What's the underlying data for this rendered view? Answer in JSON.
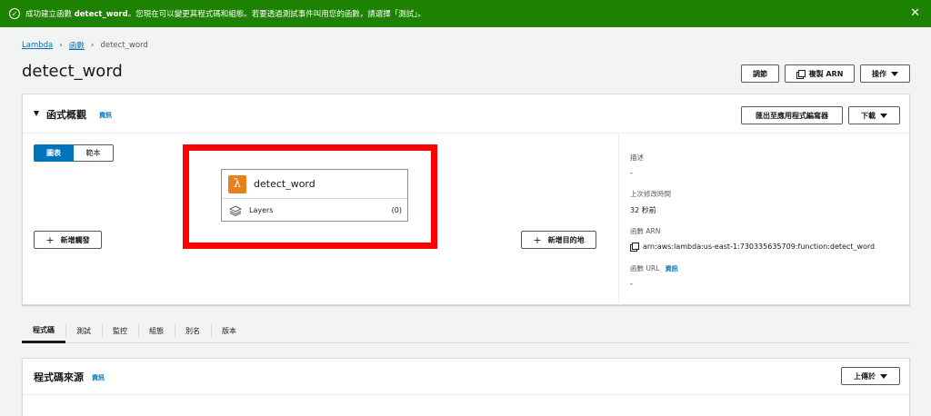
{
  "banner": {
    "prefix": "成功建立函數 ",
    "function_name": "detect_word",
    "suffix": "。您現在可以變更其程式碼和組態。若要透過測試事件叫用您的函數，請選擇「測試」。",
    "color": "#1d8102"
  },
  "breadcrumb": {
    "root": "Lambda",
    "section": "函數",
    "current": "detect_word"
  },
  "page": {
    "title": "detect_word"
  },
  "header_buttons": {
    "tune": "調節",
    "copy_arn": "複製 ARN",
    "actions": "操作"
  },
  "overview": {
    "title": "函式概觀",
    "info": "資訊",
    "export_button": "匯出至應用程式編寫器",
    "download_button": "下載",
    "view_toggle": {
      "diagram": "圖表",
      "template": "範本"
    },
    "function_card": {
      "name": "detect_word",
      "layers_label": "Layers",
      "layers_count": "(0)"
    },
    "add_trigger": "新增觸發",
    "add_destination": "新增目的地",
    "details": {
      "description_label": "描述",
      "description_value": "-",
      "last_modified_label": "上次修改時間",
      "last_modified_value": "32 秒前",
      "arn_label": "函數 ARN",
      "arn_value": "arn:aws:lambda:us-east-1:730335635709:function:detect_word",
      "url_label": "函數 URL",
      "url_info": "資訊",
      "url_value": "-"
    }
  },
  "tabs": [
    "程式碼",
    "測試",
    "監控",
    "組態",
    "別名",
    "版本"
  ],
  "code_source": {
    "title": "程式碼來源",
    "info": "資訊",
    "upload_button": "上傳於"
  },
  "colors": {
    "link": "#0073bb",
    "lambda_orange": "#e7811f",
    "highlight": "#ff0000"
  }
}
